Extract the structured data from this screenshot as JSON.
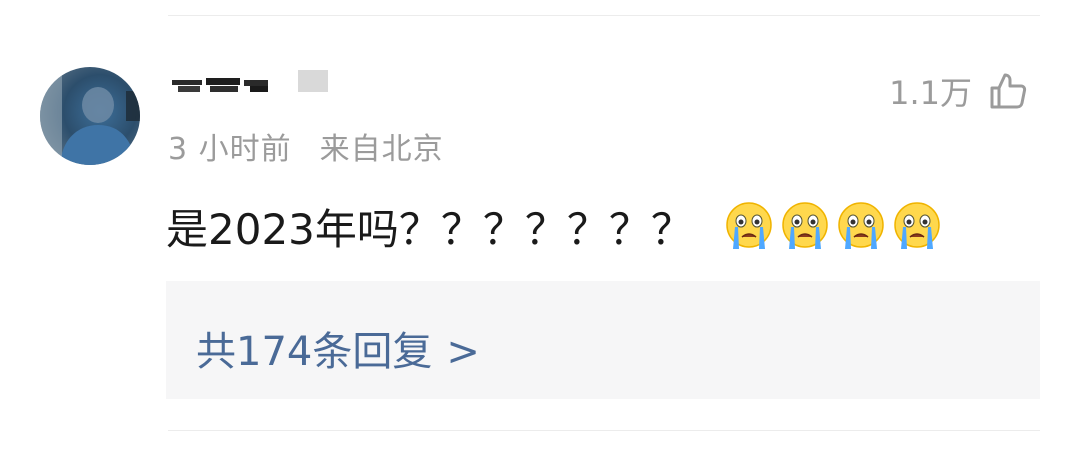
{
  "comment": {
    "meta": {
      "time": "3 小时前",
      "location": "来自北京"
    },
    "likes": {
      "count": "1.1万",
      "icon": "thumbs-up-icon"
    },
    "text": "是2023年吗？？？？？？？",
    "emojis": [
      "crying-face-icon",
      "crying-face-icon",
      "crying-face-icon",
      "crying-face-icon"
    ],
    "replies": {
      "label": "共174条回复",
      "chevron": ">"
    }
  },
  "colors": {
    "meta_gray": "#9b9b9b",
    "reply_link": "#4a6a97",
    "reply_bg": "#f6f6f7",
    "text": "#1a1a1a"
  }
}
